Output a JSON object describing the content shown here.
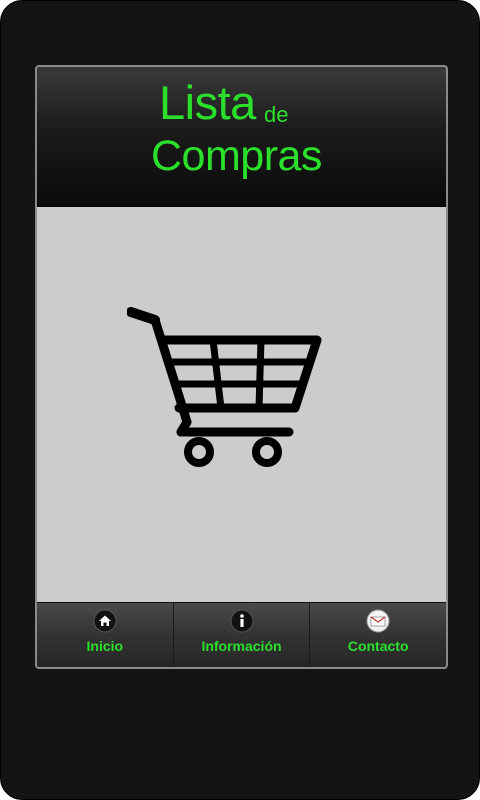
{
  "header": {
    "title_word1": "Lista",
    "title_word2": "de",
    "title_word3": "Compras"
  },
  "main": {
    "illustration": "shopping-cart-icon"
  },
  "tabs": [
    {
      "label": "Inicio",
      "icon": "home-icon"
    },
    {
      "label": "Información",
      "icon": "info-icon"
    },
    {
      "label": "Contacto",
      "icon": "mail-icon"
    }
  ],
  "colors": {
    "accent": "#2be02b",
    "header_bg": "#0a0a0a",
    "content_bg": "#cccccc",
    "device_bg": "#141414"
  }
}
